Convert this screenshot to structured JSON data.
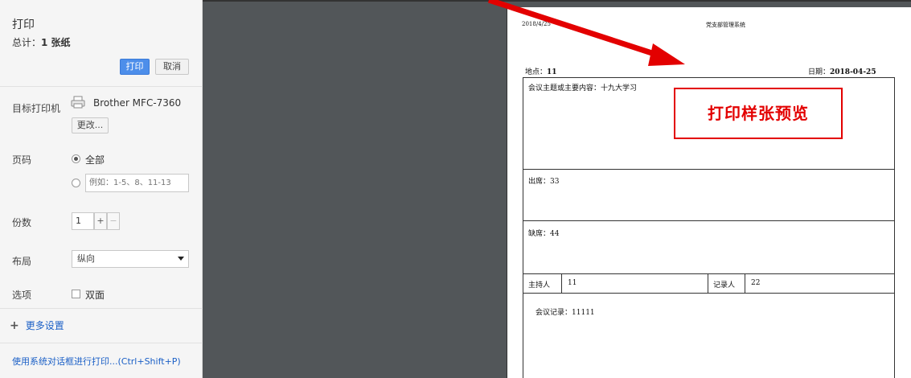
{
  "dialog": {
    "title": "打印",
    "total_prefix": "总计：",
    "total_value": "1 张纸",
    "print_button": "打印",
    "cancel_button": "取消"
  },
  "destination": {
    "label": "目标打印机",
    "printer_name": "Brother MFC-7360",
    "change_button": "更改..."
  },
  "pages": {
    "label": "页码",
    "option_all": "全部",
    "custom_placeholder": "例如：1-5、8、11-13"
  },
  "copies": {
    "label": "份数",
    "value": "1",
    "plus": "+",
    "minus": "−"
  },
  "layout": {
    "label": "布局",
    "value": "纵向"
  },
  "options": {
    "label": "选项",
    "duplex_label": "双面"
  },
  "more_settings": {
    "label": "更多设置"
  },
  "system_dialog_link": "使用系统对话框进行打印...(Ctrl+Shift+P)",
  "preview": {
    "header_date": "2018/4/25",
    "header_system": "党支部管理系统",
    "location_label": "地点：",
    "location_value": "11",
    "date_label": "日期：",
    "date_value": "2018-04-25",
    "topic": "会议主题或主要内容：十九大学习",
    "attend_label": "出席：",
    "attend_value": "33",
    "absent_label": "缺席：",
    "absent_value": "44",
    "host_label": "主持人",
    "host_value": "11",
    "recorder_label": "记录人",
    "recorder_value": "22",
    "record_label": "会议记录：",
    "record_value": "11111"
  },
  "annotation": {
    "text": "打印样张预览",
    "color": "#e30000"
  },
  "colors": {
    "accent": "#4d8eea",
    "link": "#1a5fc6",
    "preview_bg": "#525659"
  }
}
